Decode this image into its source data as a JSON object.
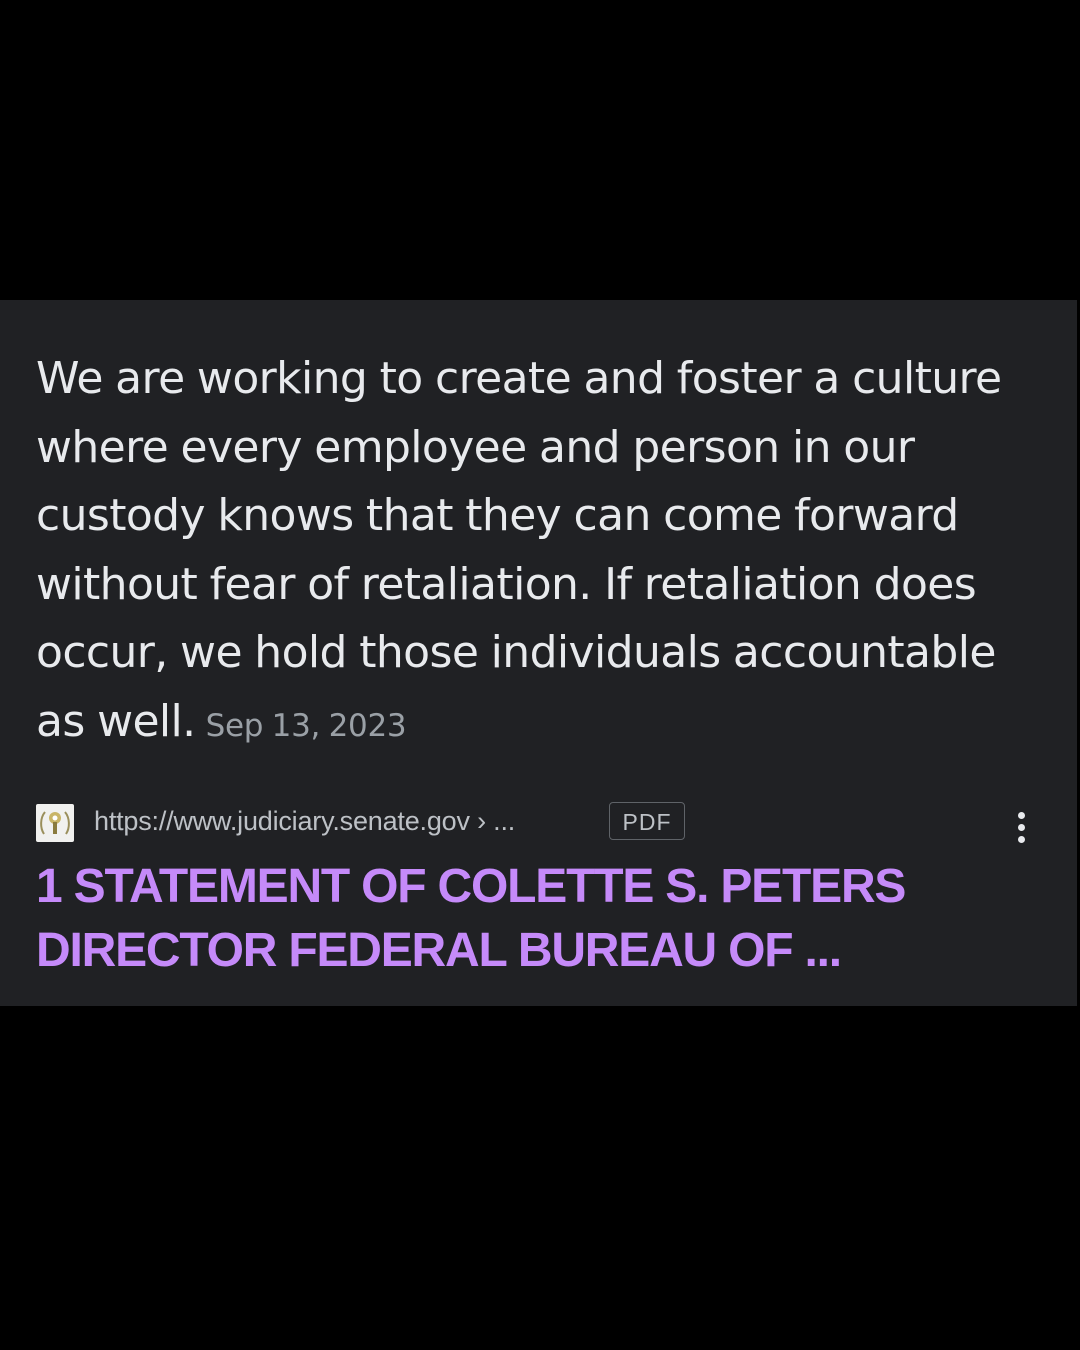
{
  "snippet": {
    "text": "We are working to create and foster a culture where every employee and person in our custody knows that they can come forward without fear of retaliation. If retaliation does occur, we hold those individuals accountable as well.",
    "date": "Sep 13, 2023"
  },
  "source": {
    "favicon_icon": "senate-seal-icon",
    "url": "https://www.judiciary.senate.gov › ...",
    "badge": "PDF",
    "more_icon": "more-vertical-icon"
  },
  "result": {
    "title": "1 STATEMENT OF COLETTE S. PETERS DIRECTOR FEDERAL BUREAU OF ..."
  },
  "colors": {
    "page_background": "#000000",
    "card_background": "#202124",
    "snippet_text": "#e8eaed",
    "secondary_text": "#9aa0a6",
    "visited_link": "#c58af9"
  }
}
